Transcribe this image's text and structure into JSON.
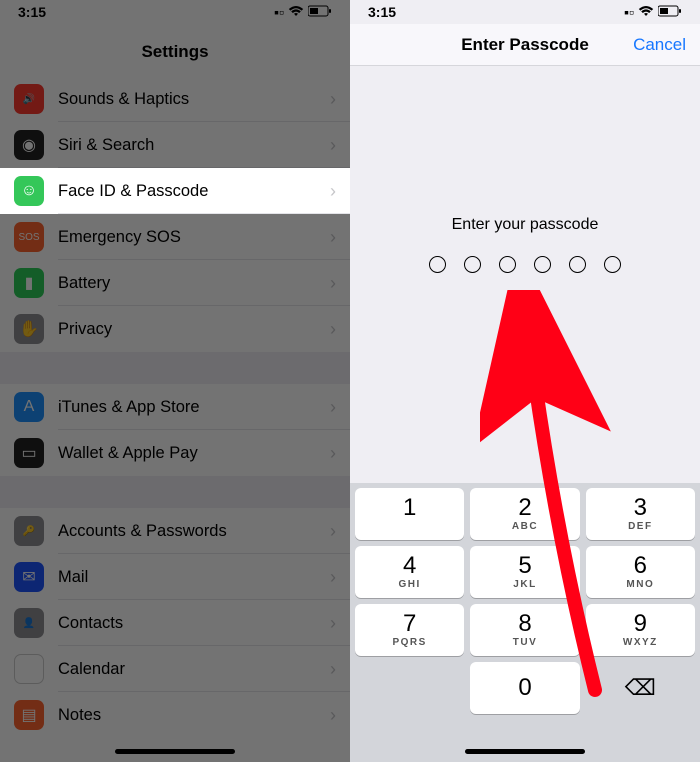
{
  "statusbar": {
    "time": "3:15"
  },
  "settings": {
    "title": "Settings",
    "rows": [
      {
        "name": "sounds-haptics",
        "label": "Sounds & Haptics",
        "icon": "🔊",
        "cls": "ic-red"
      },
      {
        "name": "siri-search",
        "label": "Siri & Search",
        "icon": "◉",
        "cls": "ic-black"
      },
      {
        "name": "face-id",
        "label": "Face ID & Passcode",
        "icon": "☺",
        "cls": "ic-green",
        "highlight": true
      },
      {
        "name": "emergency-sos",
        "label": "Emergency SOS",
        "icon": "SOS",
        "cls": "ic-orange"
      },
      {
        "name": "battery",
        "label": "Battery",
        "icon": "▮",
        "cls": "ic-greenb"
      },
      {
        "name": "privacy",
        "label": "Privacy",
        "icon": "✋",
        "cls": "ic-grey"
      }
    ],
    "rows2": [
      {
        "name": "itunes",
        "label": "iTunes & App Store",
        "icon": "A",
        "cls": "ic-blue"
      },
      {
        "name": "wallet",
        "label": "Wallet & Apple Pay",
        "icon": "▭",
        "cls": "ic-black"
      }
    ],
    "rows3": [
      {
        "name": "accounts",
        "label": "Accounts & Passwords",
        "icon": "🔑",
        "cls": "ic-grey"
      },
      {
        "name": "mail",
        "label": "Mail",
        "icon": "✉",
        "cls": "ic-darkblue"
      },
      {
        "name": "contacts",
        "label": "Contacts",
        "icon": "👤",
        "cls": "ic-grey"
      },
      {
        "name": "calendar",
        "label": "Calendar",
        "icon": "▦",
        "cls": "ic-cal"
      },
      {
        "name": "notes",
        "label": "Notes",
        "icon": "▤",
        "cls": "ic-orange"
      }
    ]
  },
  "passcode": {
    "navTitle": "Enter Passcode",
    "cancel": "Cancel",
    "prompt": "Enter your passcode",
    "digits": 6,
    "keys": [
      {
        "n": "1",
        "l": ""
      },
      {
        "n": "2",
        "l": "ABC"
      },
      {
        "n": "3",
        "l": "DEF"
      },
      {
        "n": "4",
        "l": "GHI"
      },
      {
        "n": "5",
        "l": "JKL"
      },
      {
        "n": "6",
        "l": "MNO"
      },
      {
        "n": "7",
        "l": "PQRS"
      },
      {
        "n": "8",
        "l": "TUV"
      },
      {
        "n": "9",
        "l": "WXYZ"
      }
    ],
    "zero": "0"
  }
}
